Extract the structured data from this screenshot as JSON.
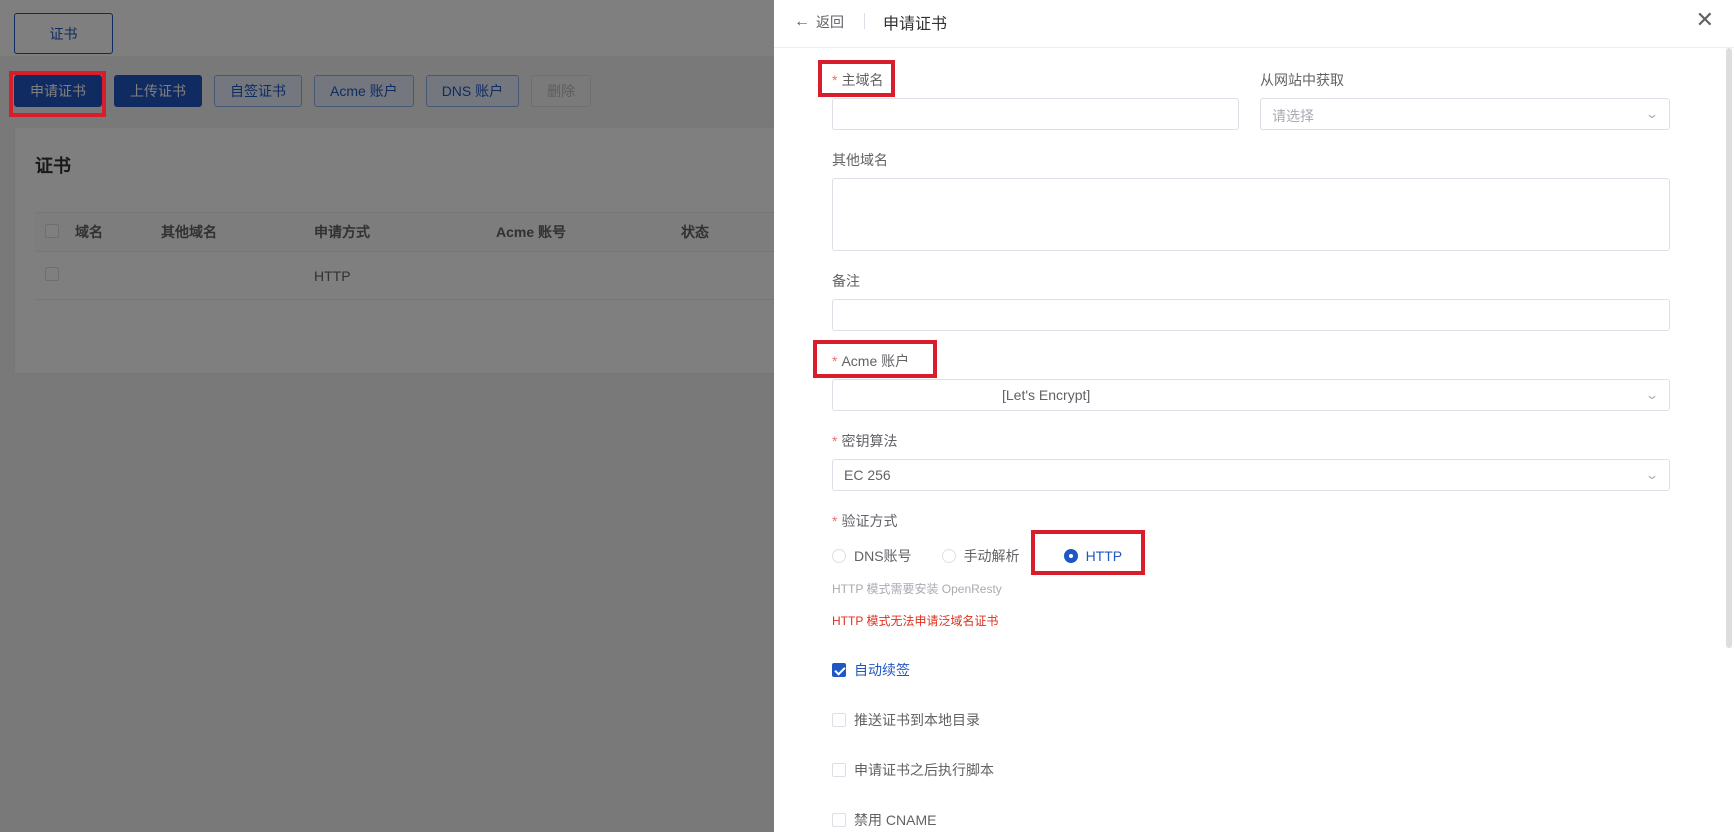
{
  "background": {
    "tab_label": "证书",
    "toolbar": {
      "apply_label": "申请证书",
      "upload_label": "上传证书",
      "self_signed_label": "自签证书",
      "acme_account_label": "Acme 账户",
      "dns_account_label": "DNS 账户",
      "delete_label": "删除"
    },
    "card_title": "证书",
    "table": {
      "headers": [
        "域名",
        "其他域名",
        "申请方式",
        "Acme 账号",
        "状态"
      ],
      "rows": [
        {
          "domain": "",
          "other": "",
          "method": "HTTP",
          "acme": "",
          "status": ""
        }
      ]
    }
  },
  "drawer": {
    "back_label": "返回",
    "title": "申请证书",
    "fields": {
      "primary_domain_label": "主域名",
      "primary_domain_value": "",
      "from_website_label": "从网站中获取",
      "from_website_placeholder": "请选择",
      "other_domains_label": "其他域名",
      "remark_label": "备注",
      "acme_account_label": "Acme 账户",
      "acme_account_value": "[Let's Encrypt]",
      "key_algo_label": "密钥算法",
      "key_algo_value": "EC 256",
      "verify_label": "验证方式",
      "verify_options": [
        "DNS账号",
        "手动解析",
        "HTTP"
      ],
      "verify_selected": "HTTP",
      "hint_openresty": "HTTP 模式需要安装 OpenResty",
      "warn_wildcard": "HTTP 模式无法申请泛域名证书",
      "auto_renew_label": "自动续签",
      "push_local_label": "推送证书到本地目录",
      "exec_script_label": "申请证书之后执行脚本",
      "disable_cname_label": "禁用 CNAME"
    }
  },
  "colors": {
    "primary": "#1f57c3",
    "highlight": "#d81e2a",
    "warning_text": "#e0301e"
  }
}
